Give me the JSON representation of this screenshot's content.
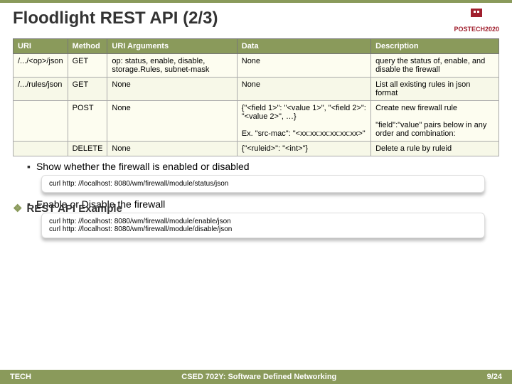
{
  "header": {
    "title": "Floodlight REST API (2/3)",
    "logo_text": "POSTECH",
    "logo_year": "2020"
  },
  "table": {
    "headers": [
      "URI",
      "Method",
      "URI Arguments",
      "Data",
      "Description"
    ],
    "rows": [
      {
        "uri": "/.../<op>/json",
        "method": "GET",
        "args": "op: status, enable, disable, storage.Rules, subnet-mask",
        "data": "None",
        "desc": "query the status of, enable, and disable the firewall"
      },
      {
        "uri": "/.../rules/json",
        "method": "GET",
        "args": "None",
        "data": "None",
        "desc": "List all existing rules in json format"
      },
      {
        "uri": "",
        "method": "POST",
        "args": "None",
        "data": "{\"<field 1>\": \"<value 1>\", \"<field 2>\": \"<value 2>\", …}\n\nEx. \"src-mac\": \"<xx:xx:xx:xx:xx:xx>\"",
        "desc": "Create new firewall rule\n\n\"field\":\"value\" pairs below in any order and combination:"
      },
      {
        "uri": "",
        "method": "DELETE",
        "args": "None",
        "data": "{\"<ruleid>\": \"<int>\"}",
        "desc": "Delete a rule by ruleid"
      }
    ]
  },
  "overlay_heading": "REST API Example",
  "sections": [
    {
      "bullet": "Show whether the firewall is enabled or disabled",
      "code": [
        "curl http: //localhost: 8080/wm/firewall/module/status/json"
      ]
    },
    {
      "bullet": "Enable or Disable the firewall",
      "code": [
        "curl http: //localhost: 8080/wm/firewall/module/enable/json",
        "curl http: //localhost: 8080/wm/firewall/module/disable/json"
      ]
    }
  ],
  "footer": {
    "left": "TECH",
    "center": "CSED 702Y: Software Defined Networking",
    "right": "9/24"
  }
}
